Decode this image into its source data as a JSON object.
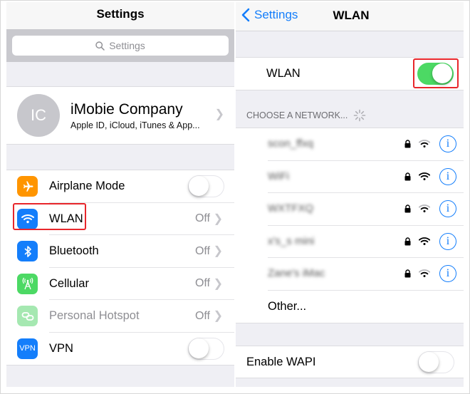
{
  "left_screen": {
    "title": "Settings",
    "search": {
      "placeholder": "Settings",
      "icon": "search-icon"
    },
    "profile": {
      "initials": "IC",
      "name": "iMobie Company",
      "subtitle": "Apple ID, iCloud, iTunes & App..."
    },
    "settings_items": [
      {
        "label": "Airplane Mode",
        "icon": "airplane-icon",
        "icon_color": "#ff9500",
        "control": "toggle",
        "toggle_on": false
      },
      {
        "label": "WLAN",
        "icon": "wifi-icon",
        "icon_color": "#147efb",
        "value": "Off",
        "control": "chevron",
        "highlighted": true
      },
      {
        "label": "Bluetooth",
        "icon": "bluetooth-icon",
        "icon_color": "#147efb",
        "value": "Off",
        "control": "chevron"
      },
      {
        "label": "Cellular",
        "icon": "cellular-antenna-icon",
        "icon_color": "#4cd964",
        "value": "Off",
        "control": "chevron"
      },
      {
        "label": "Personal Hotspot",
        "icon": "hotspot-link-icon",
        "icon_color": "#a5e8b1",
        "value": "Off",
        "control": "chevron",
        "disabled": true
      },
      {
        "label": "VPN",
        "icon": "vpn-icon",
        "icon_text": "VPN",
        "icon_color": "#147efb",
        "control": "toggle",
        "toggle_on": false
      }
    ]
  },
  "right_screen": {
    "back_label": "Settings",
    "title": "WLAN",
    "wlan_toggle": {
      "label": "WLAN",
      "on": true,
      "highlighted": true
    },
    "section_header": "CHOOSE A NETWORK...",
    "networks": [
      {
        "name": "scon_ffxq",
        "secured": true,
        "signal": "medium"
      },
      {
        "name": "WiFi",
        "secured": true,
        "signal": "full"
      },
      {
        "name": "WXTFXQ",
        "secured": true,
        "signal": "medium"
      },
      {
        "name": "x's_s mini",
        "secured": true,
        "signal": "full"
      },
      {
        "name": "Zane's iMac",
        "secured": true,
        "signal": "medium"
      }
    ],
    "other_label": "Other...",
    "wapi": {
      "label": "Enable WAPI",
      "on": false
    }
  },
  "colors": {
    "accent_blue": "#147efb",
    "toggle_green": "#4cd964",
    "highlight_red": "#e8262b"
  }
}
